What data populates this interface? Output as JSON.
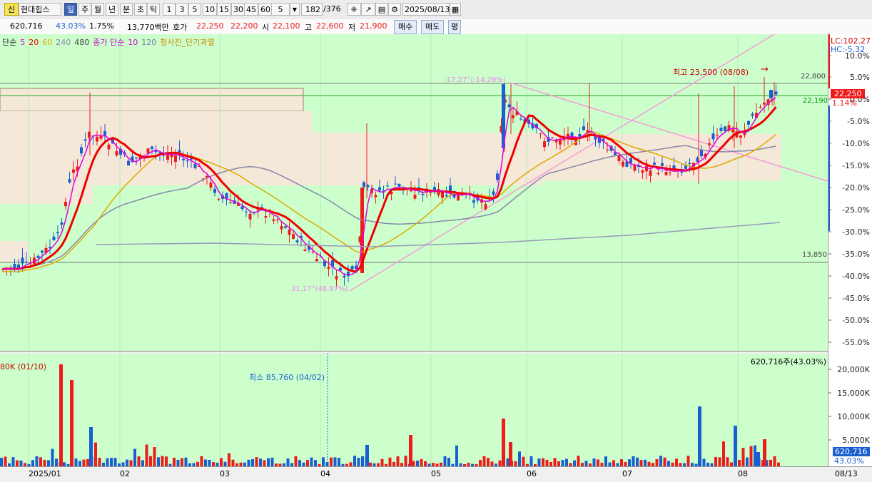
{
  "toolbar": {
    "badge": "신",
    "stock_name": "현대힙스",
    "periods": [
      "일",
      "주",
      "월",
      "년",
      "분",
      "초",
      "틱"
    ],
    "minutes": [
      "1",
      "3",
      "5",
      "10",
      "15",
      "30",
      "45",
      "60"
    ],
    "interval": "5",
    "count": "182",
    "total": "/376",
    "date": "2025/08/13"
  },
  "info": {
    "volume": "620,716",
    "vol_ratio": "43.03%",
    "rate": "1.75%",
    "amount": "13,770백만",
    "quote_label": "호가",
    "ask": "22,250",
    "bid": "22,200",
    "open_label": "시",
    "open": "22,100",
    "high_label": "고",
    "high": "22,600",
    "low_label": "저",
    "low": "21,900",
    "buy": "매수",
    "sell": "매도",
    "flat": "평"
  },
  "legend": [
    {
      "text": "단순",
      "color": "#333333"
    },
    {
      "text": "5",
      "color": "#e000e0"
    },
    {
      "text": "20",
      "color": "#ee0000"
    },
    {
      "text": "60",
      "color": "#ddaa00"
    },
    {
      "text": "240",
      "color": "#8888aa"
    },
    {
      "text": "480",
      "color": "#444444"
    },
    {
      "text": "종가 단순",
      "color": "#cc00cc"
    },
    {
      "text": "10",
      "color": "#cc00cc"
    },
    {
      "text": "120",
      "color": "#7777aa"
    },
    {
      "text": "청사진_단기과열",
      "color": "#cc8800"
    }
  ],
  "annotations": {
    "max_label": "최고 23,500 (08/08)",
    "min_label": "31,17°(48,87%)",
    "angle_label": "-17.27°(-14.29%)",
    "level_high": "22,800",
    "level_cur": "22,190",
    "level_low": "13,850",
    "vol_max": "80K (01/10)",
    "vol_min": "최소 85,760 (04/02)",
    "vol_current": "620,716주(43.03%)"
  },
  "right_axis": {
    "lc": "LC:102.27",
    "hc": "HC:-5.32",
    "price": "22,250",
    "pct": "1.14%",
    "ticks": [
      "10.0%",
      "5.0%",
      "0.0%",
      "-5.0%",
      "-10.0%",
      "-15.0%",
      "-20.0%",
      "-25.0%",
      "-30.0%",
      "-35.0%",
      "-40.0%",
      "-45.0%",
      "-50.0%",
      "-55.0%"
    ],
    "vol_ticks": [
      "20,000K",
      "15,000K",
      "10,000K",
      "5,000K"
    ],
    "vol_val": "620,716",
    "vol_pct": "43.03%"
  },
  "x_axis": {
    "labels": [
      "2025/01",
      "02",
      "03",
      "04",
      "05",
      "06",
      "07",
      "08"
    ],
    "end": "08/13"
  },
  "colors": {
    "up": "#ee1c1c",
    "down": "#1a5fd0",
    "bg": "#ccffcc",
    "ma5": "#e000e0",
    "ma20": "#ee0000",
    "ma60": "#ddaa00",
    "ma120": "#7777aa",
    "ma240": "#8888aa"
  }
}
